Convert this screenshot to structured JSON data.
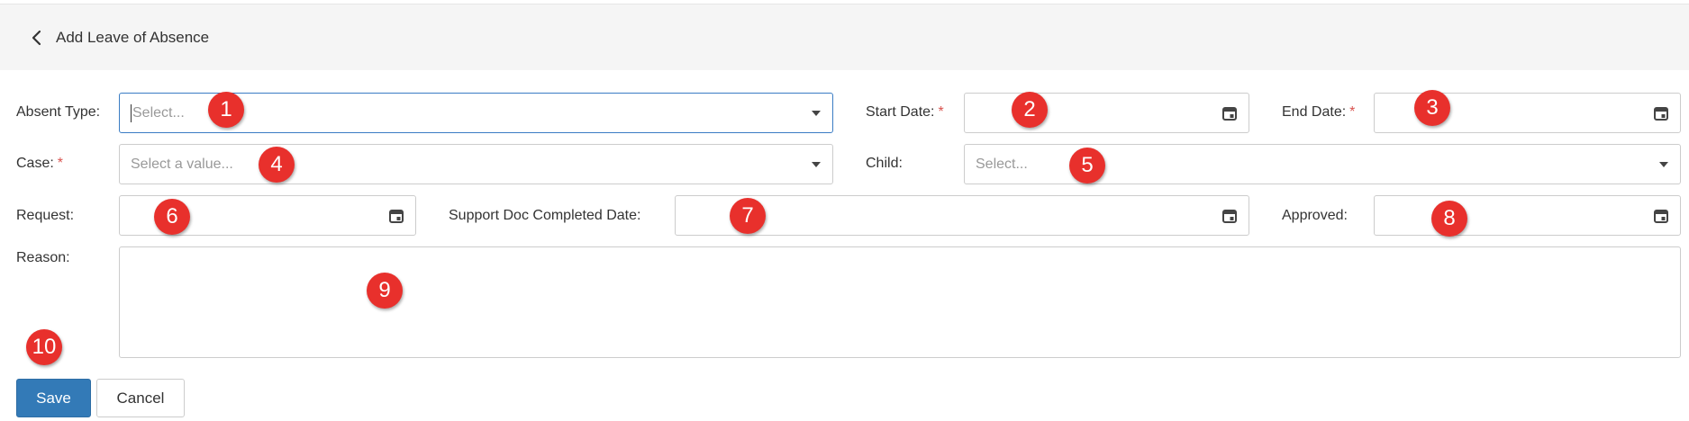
{
  "header": {
    "title": "Add Leave of Absence",
    "back_icon": "chevron-left-icon"
  },
  "form": {
    "absent_type": {
      "label": "Absent Type:",
      "placeholder": "Select..."
    },
    "start_date": {
      "label": "Start Date:",
      "required_mark": "*"
    },
    "end_date": {
      "label": "End Date:",
      "required_mark": "*"
    },
    "case": {
      "label": "Case:",
      "required_mark": "*",
      "placeholder": "Select a value..."
    },
    "child": {
      "label": "Child:",
      "placeholder": "Select..."
    },
    "request": {
      "label": "Request:"
    },
    "support_doc_completed_date": {
      "label": "Support Doc Completed Date:"
    },
    "approved": {
      "label": "Approved:"
    },
    "reason": {
      "label": "Reason:",
      "value": ""
    }
  },
  "actions": {
    "save_label": "Save",
    "cancel_label": "Cancel"
  },
  "markers": [
    "1",
    "2",
    "3",
    "4",
    "5",
    "6",
    "7",
    "8",
    "9",
    "10"
  ],
  "colors": {
    "primary": "#337ab7",
    "required": "#d9534f",
    "marker": "#e8302c",
    "focus_border": "#3a7cc4"
  }
}
